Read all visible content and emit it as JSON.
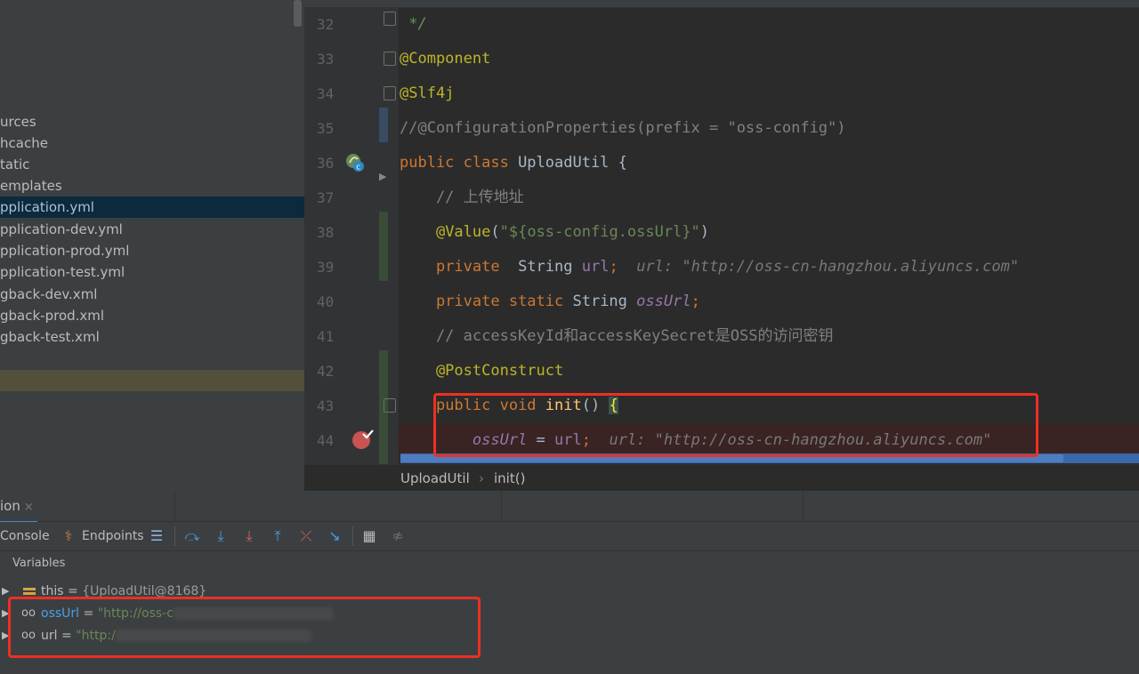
{
  "sidebar": {
    "items": [
      {
        "label": "urces"
      },
      {
        "label": "hcache"
      },
      {
        "label": "tatic"
      },
      {
        "label": "emplates"
      },
      {
        "label": "pplication.yml",
        "selected": true
      },
      {
        "label": "pplication-dev.yml"
      },
      {
        "label": "pplication-prod.yml"
      },
      {
        "label": "pplication-test.yml"
      },
      {
        "label": "gback-dev.xml"
      },
      {
        "label": "gback-prod.xml"
      },
      {
        "label": "gback-test.xml"
      }
    ]
  },
  "editor": {
    "lines": [
      {
        "n": "32",
        "code": " */"
      },
      {
        "n": "33",
        "code": "@Component"
      },
      {
        "n": "34",
        "code": "@Slf4j"
      },
      {
        "n": "35",
        "code": "//@ConfigurationProperties(prefix = \"oss-config\")"
      },
      {
        "n": "36",
        "code": "public class UploadUtil {"
      },
      {
        "n": "37",
        "code": "    // 上传地址"
      },
      {
        "n": "38",
        "code": "    @Value(\"${oss-config.ossUrl}\")"
      },
      {
        "n": "39",
        "code": "    private  String url;  url: \"http://oss-cn-hangzhou.aliyuncs.com\""
      },
      {
        "n": "40",
        "code": "    private static String ossUrl;"
      },
      {
        "n": "41",
        "code": "    // accessKeyId和accessKeySecret是OSS的访问密钥"
      },
      {
        "n": "42",
        "code": "    @PostConstruct"
      },
      {
        "n": "43",
        "code": "    public void init() {"
      },
      {
        "n": "44",
        "code": "        ossUrl = url;  url: \"http://oss-cn-hangzhou.aliyuncs.com\""
      }
    ],
    "breadcrumb": [
      "UploadUtil",
      "init()"
    ],
    "breadcrumb_sep": "›"
  },
  "debug": {
    "tab_label": "ion",
    "tab_close": "×",
    "console_label": "Console",
    "endpoints_label": "Endpoints",
    "variables_title": "Variables",
    "variables": [
      {
        "name": "this",
        "eq": " = ",
        "value": "{UploadUtil@8168}"
      },
      {
        "name": "ossUrl",
        "eq": " = ",
        "value": "\"http://oss-c"
      },
      {
        "name": "url",
        "eq": " = ",
        "value": "\"http:/"
      }
    ]
  },
  "colors": {
    "keyword": "#cc7832",
    "annotation": "#bbb529",
    "string": "#6a8759",
    "comment": "#808080",
    "field": "#9876aa",
    "highlight_box": "#ec3025",
    "accent": "#4a88c7"
  }
}
